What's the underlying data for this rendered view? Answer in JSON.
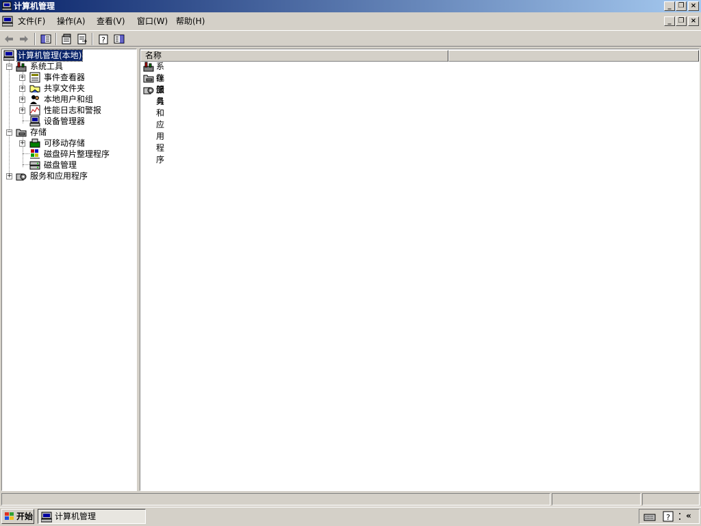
{
  "window": {
    "title": "计算机管理"
  },
  "menu": [
    "文件(F)",
    "操作(A)",
    "查看(V)",
    "窗口(W)",
    "帮助(H)"
  ],
  "caption_buttons": {
    "minimize": "_",
    "restore": "❐",
    "close": "×"
  },
  "toolbar": {
    "back_icon": "arrow-left-icon",
    "forward_icon": "arrow-right-icon",
    "show_tree_icon": "show-hide-tree-icon",
    "properties_icon": "properties-icon",
    "export_icon": "export-list-icon",
    "help_icon": "help-icon",
    "console_icon": "console-tree-icon"
  },
  "tree": {
    "root": "计算机管理(本地)",
    "system_tools": "系统工具",
    "event_viewer": "事件查看器",
    "shared_folders": "共享文件夹",
    "local_users": "本地用户和组",
    "perf_logs": "性能日志和警报",
    "device_manager": "设备管理器",
    "storage": "存储",
    "removable_storage": "可移动存储",
    "defrag": "磁盘碎片整理程序",
    "disk_management": "磁盘管理",
    "services_apps": "服务和应用程序"
  },
  "list": {
    "column_name": "名称",
    "items": [
      "系统工具",
      "存储",
      "服务和应用程序"
    ]
  },
  "taskbar": {
    "start": "开始",
    "task": "计算机管理"
  },
  "colors": {
    "title_start": "#0a246a",
    "title_end": "#a6caf0",
    "face": "#d4d0c8"
  }
}
